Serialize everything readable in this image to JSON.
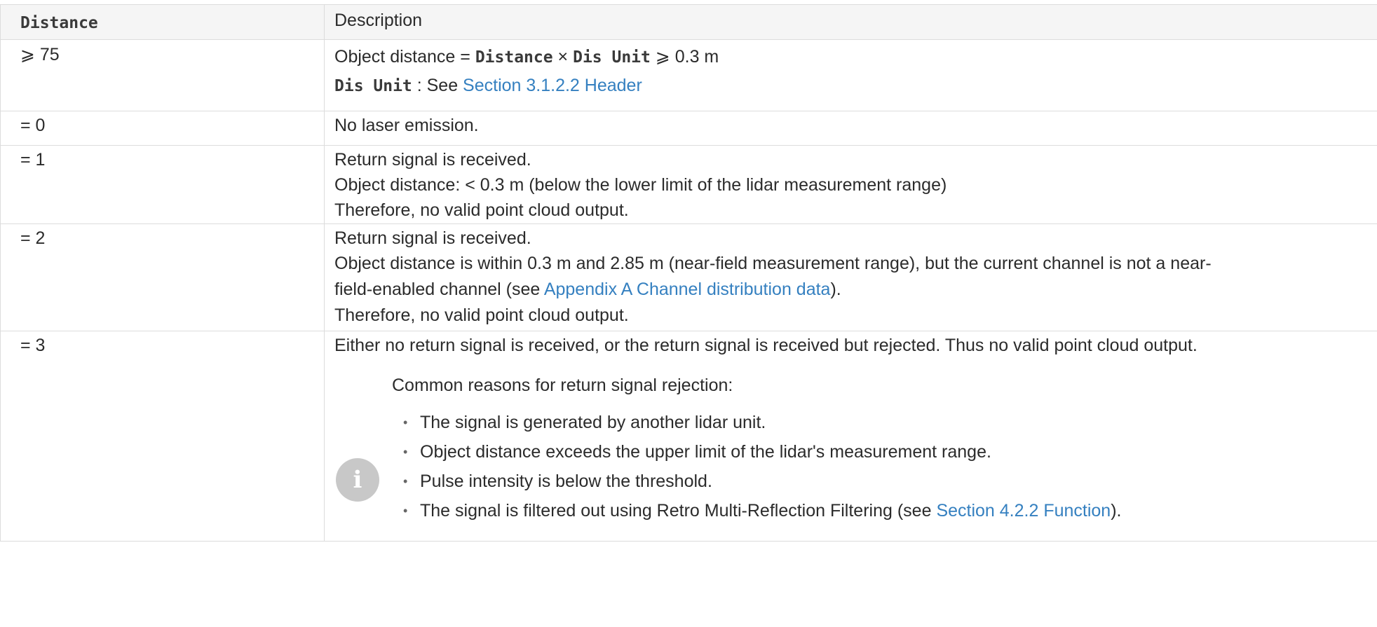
{
  "header": {
    "col1": "Distance",
    "col2": "Description"
  },
  "rows": [
    {
      "distance": "⩾ 75",
      "line1": {
        "prefix": "Object distance = ",
        "code1": "Distance",
        "times": " × ",
        "code2": "Dis Unit",
        "suffix": " ⩾ 0.3 m"
      },
      "line2": {
        "code": "Dis Unit",
        "text": " : See ",
        "link": "Section 3.1.2.2 Header"
      }
    },
    {
      "distance": "= 0",
      "lines": [
        "No laser emission."
      ]
    },
    {
      "distance": "= 1",
      "lines": [
        "Return signal is received.",
        "Object distance: < 0.3 m (below the lower limit of the lidar measurement range)",
        "Therefore, no valid point cloud output."
      ]
    },
    {
      "distance": "= 2",
      "line1": "Return signal is received.",
      "line2a": "Object distance is within 0.3 m and 2.85 m (near-field measurement range), but the current channel is not a near-",
      "line2b_prefix": "field-enabled channel (see ",
      "line2b_link": "Appendix A Channel distribution data",
      "line2b_suffix": ").",
      "line3": "Therefore, no valid point cloud output."
    },
    {
      "distance": "= 3",
      "text": "Either no return signal is received, or the return signal is received but rejected. Thus no valid point cloud output.",
      "note": {
        "icon": "info-icon",
        "title": "Common reasons for return signal rejection:",
        "items": [
          "The signal is generated by another lidar unit.",
          "Object distance exceeds the upper limit of the lidar's measurement range.",
          "Pulse intensity is below the threshold."
        ],
        "last_item": {
          "prefix": "The signal is filtered out using Retro Multi-Reflection Filtering (see ",
          "link": "Section 4.2.2 Function",
          "suffix": ")."
        }
      }
    }
  ],
  "colors": {
    "link": "#3580c0",
    "header_bg": "#f5f5f5",
    "border": "#dcdcdc",
    "icon_bg": "#c8c8c8"
  }
}
